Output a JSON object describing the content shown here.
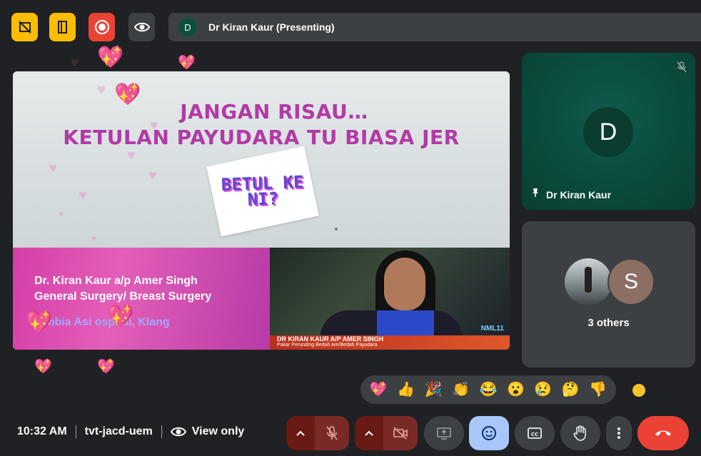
{
  "top_bar": {
    "buttons": [
      "hide-tiles",
      "exit-building",
      "recording",
      "view-only"
    ],
    "presenter": {
      "avatar_letter": "D",
      "label": "Dr Kiran Kaur (Presenting)"
    }
  },
  "slide": {
    "title_line1": "JANGAN RISAU…",
    "title_line2": "KETULAN PAYUDARA TU BIASA JER",
    "sticker_text": "BETUL KE NI?",
    "banner": {
      "name": "Dr. Kiran Kaur a/p Amer Singh",
      "specialty": "General Surgery/ Breast Surgery",
      "hospital": "lumbia Asi   ospital, Klang"
    },
    "video_caption": {
      "name": "DR KIRAN KAUR A/P AMER SINGH",
      "subtitle": "Pakar Perunding Bedah Am/Bedah Payudara",
      "channel": "NML11"
    }
  },
  "participants": {
    "main": {
      "avatar_letter": "D",
      "name": "Dr Kiran Kaur",
      "muted": true
    },
    "others": {
      "avatar_letter": "S",
      "label": "3 others"
    }
  },
  "reactions": [
    "💖",
    "👍",
    "🎉",
    "👏",
    "😂",
    "😮",
    "😢",
    "🤔",
    "👎"
  ],
  "skin_tone_color": "#f8c22b",
  "bottom_bar": {
    "time": "10:32 AM",
    "meeting_code": "tvt-jacd-uem",
    "mode": "View only"
  },
  "colors": {
    "accent_yellow": "#fbbc04",
    "record_red": "#ea4335",
    "tile_green": "#0a4a3c",
    "active_blue": "#a8c7fa"
  }
}
